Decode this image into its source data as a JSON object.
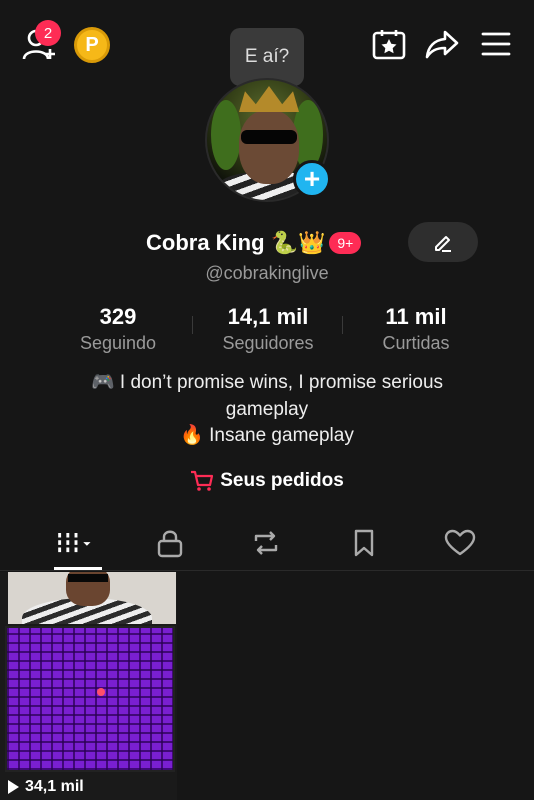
{
  "header": {
    "notification_count": "2",
    "coin_label": "P",
    "tooltip": "E aí?"
  },
  "profile": {
    "display_name": "Cobra King",
    "name_emojis": "🐍👑",
    "badge": "9+",
    "username": "@cobrakinglive"
  },
  "stats": [
    {
      "value": "329",
      "label": "Seguindo"
    },
    {
      "value": "14,1 mil",
      "label": "Seguidores"
    },
    {
      "value": "11 mil",
      "label": "Curtidas"
    }
  ],
  "bio": {
    "line1": "🎮 I don’t promise wins, I promise serious",
    "line2": "gameplay",
    "line3": "🔥 Insane gameplay"
  },
  "orders": {
    "label": "Seus pedidos"
  },
  "videos": [
    {
      "views": "34,1 mil"
    }
  ],
  "colors": {
    "background": "#161616",
    "accent_red": "#fe2c55",
    "accent_blue": "#20b5f0",
    "coin": "#f6b818"
  }
}
